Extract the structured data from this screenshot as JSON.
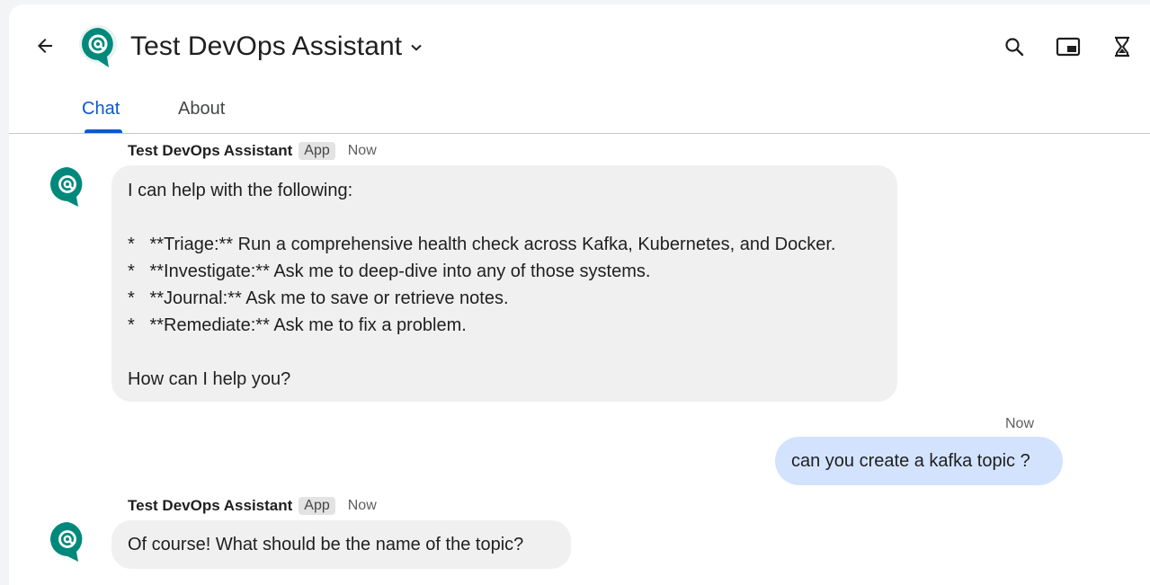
{
  "header": {
    "title": "Test DevOps Assistant",
    "icons": [
      "back-arrow-icon",
      "chat-at-logo-icon",
      "chevron-down-icon",
      "search-icon",
      "picture-in-picture-icon",
      "hourglass-icon"
    ]
  },
  "tabs": [
    {
      "label": "Chat",
      "active": true
    },
    {
      "label": "About",
      "active": false
    }
  ],
  "messages": {
    "m1": {
      "sender": "Test DevOps Assistant",
      "badge": "App",
      "time": "Now",
      "lines": [
        "I can help with the following:",
        "",
        "*   **Triage:** Run a comprehensive health check across Kafka, Kubernetes, and Docker.",
        "*   **Investigate:** Ask me to deep-dive into any of those systems.",
        "*   **Journal:** Ask me to save or retrieve notes.",
        "*   **Remediate:** Ask me to fix a problem.",
        "",
        "How can I help you?"
      ]
    },
    "m2": {
      "time": "Now",
      "text": "can you create a kafka topic ?"
    },
    "m3": {
      "sender": "Test DevOps Assistant",
      "badge": "App",
      "time": "Now",
      "text": "Of course! What should be the name of the topic?"
    }
  },
  "colors": {
    "accent": "#0b57d0",
    "logo": "#00897b",
    "bot_bubble": "#f0f0f0",
    "user_bubble": "#d3e3fd"
  }
}
